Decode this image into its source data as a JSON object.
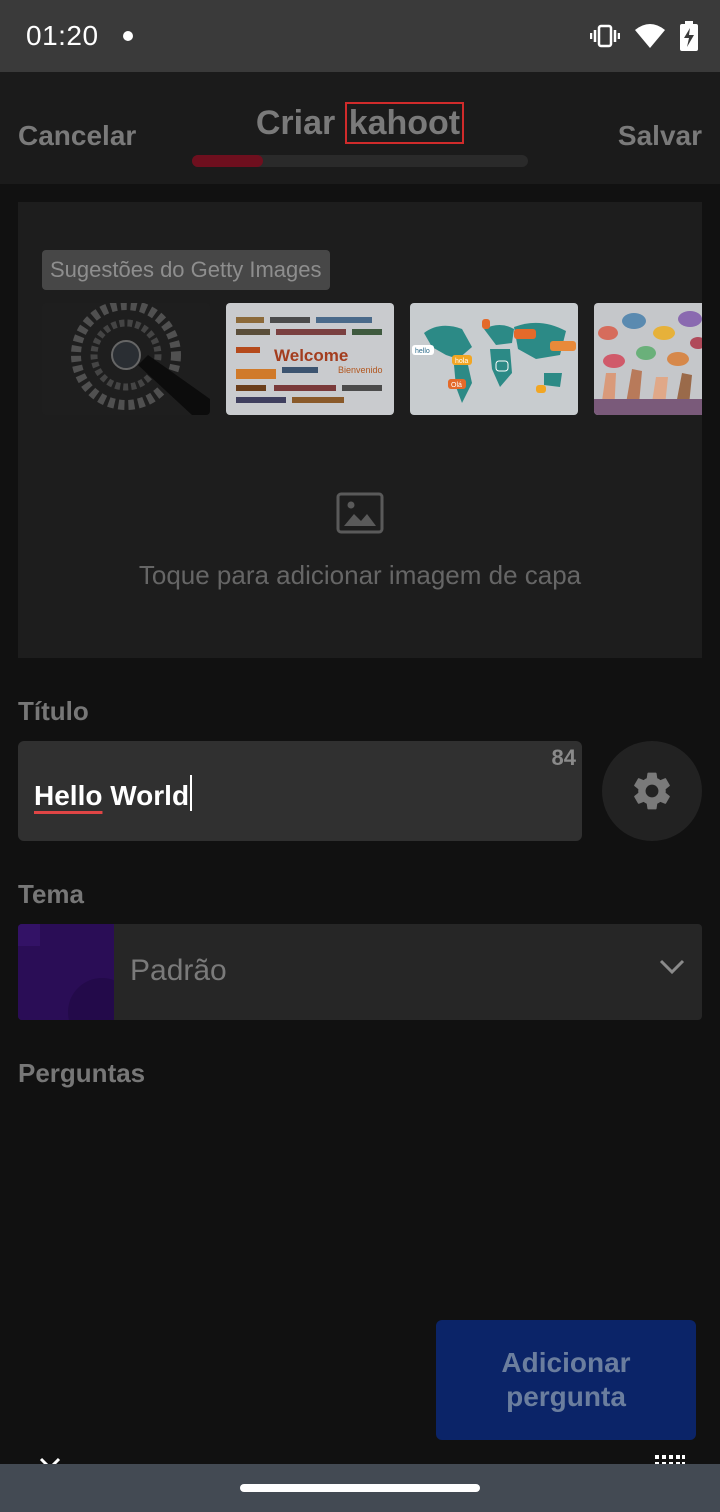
{
  "status_bar": {
    "time": "01:20",
    "icons": [
      "vibrate-icon",
      "wifi-icon",
      "battery-charging-icon"
    ]
  },
  "header": {
    "cancel_label": "Cancelar",
    "title_word1": "Criar",
    "title_word2": "kahoot",
    "save_label": "Salvar",
    "progress_fraction": 0.21
  },
  "cover": {
    "getty_label": "Sugestões do Getty Images",
    "thumbnails": [
      "welcome-globe-words-image",
      "welcome-word-cloud-image",
      "world-map-speech-bubbles-image",
      "hands-holding-speech-bubbles-image"
    ],
    "thumb_texts": {
      "welcome": "Welcome",
      "bienvenido": "Bienvenido",
      "hello": "hello",
      "hola": "hola",
      "ola": "Olá"
    },
    "add_cover_text": "Toque para adicionar imagem de capa"
  },
  "title_section": {
    "label": "Título",
    "value_word1": "Hello",
    "value_word2": "World",
    "char_remaining": "84"
  },
  "theme_section": {
    "label": "Tema",
    "selected": "Padrão"
  },
  "questions_section": {
    "label": "Perguntas"
  },
  "add_question": {
    "line1": "Adicionar",
    "line2": "pergunta"
  },
  "colors": {
    "progress_fill": "#6e0f1e",
    "add_button": "#0b2468",
    "title_highlight_border": "#d02b2b",
    "theme_thumb": "#2a0d56"
  }
}
